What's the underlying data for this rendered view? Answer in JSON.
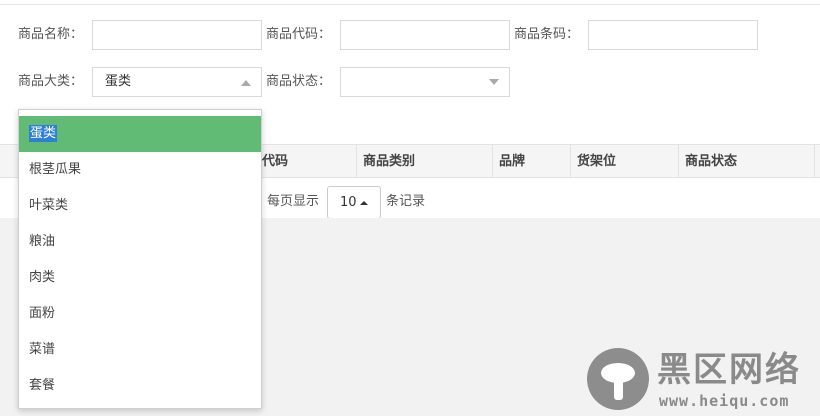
{
  "search_form": {
    "product_name_label": "商品名称：",
    "product_code_label": "商品代码：",
    "barcode_label": "商品条码：",
    "category_label": "商品大类：",
    "category_value": "蛋类",
    "status_label": "商品状态：",
    "status_value": ""
  },
  "category_dropdown": {
    "options": [
      "蛋类",
      "根茎瓜果",
      "叶菜类",
      "粮油",
      "肉类",
      "面粉",
      "菜谱",
      "套餐"
    ],
    "selected_index": 0
  },
  "table": {
    "headers": [
      "代码",
      "商品类别",
      "品牌",
      "货架位",
      "商品状态"
    ]
  },
  "pagination": {
    "per_page_prefix": "每页显示",
    "page_size": "10",
    "per_page_suffix": "条记录"
  },
  "watermark": {
    "title": "黑区网络",
    "url": "www.heiqu.com"
  },
  "colors": {
    "selected_option_bg": "#62bb75",
    "text_highlight": "#2f7fd6",
    "header_bg": "#f5f5f5",
    "page_bg": "#f2f2f2"
  }
}
